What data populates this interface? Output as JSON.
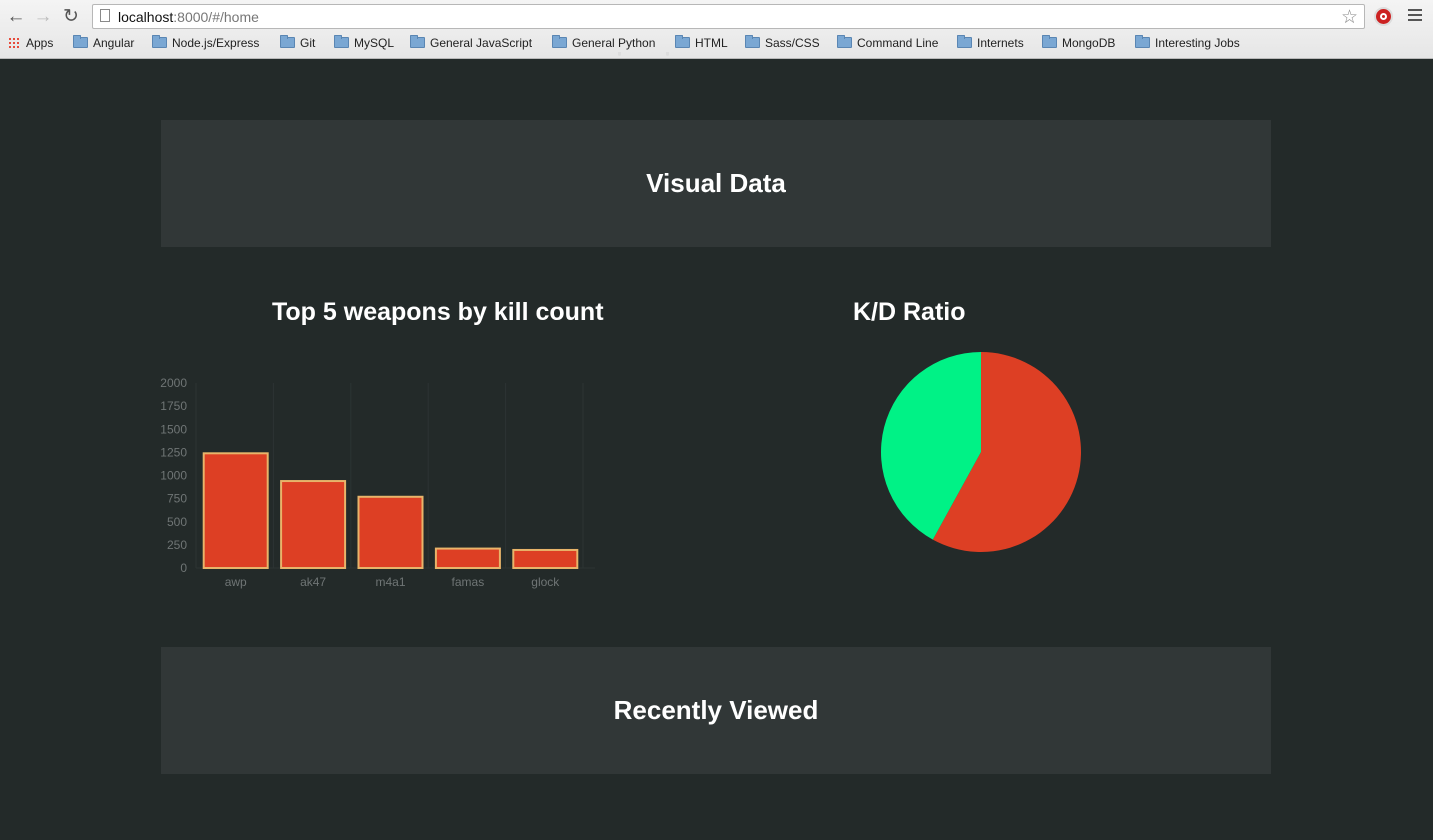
{
  "browser": {
    "url_host": "localhost",
    "url_path": ":8000/#/home",
    "bookmarks": [
      {
        "label": "Apps",
        "icon": "apps-grid-icon"
      },
      {
        "label": "Angular",
        "icon": "folder-icon"
      },
      {
        "label": "Node.js/Express",
        "icon": "folder-icon"
      },
      {
        "label": "Git",
        "icon": "folder-icon"
      },
      {
        "label": "MySQL",
        "icon": "folder-icon"
      },
      {
        "label": "General JavaScript",
        "icon": "folder-icon"
      },
      {
        "label": "General Python",
        "icon": "folder-icon"
      },
      {
        "label": "HTML",
        "icon": "folder-icon"
      },
      {
        "label": "Sass/CSS",
        "icon": "folder-icon"
      },
      {
        "label": "Command Line",
        "icon": "folder-icon"
      },
      {
        "label": "Internets",
        "icon": "folder-icon"
      },
      {
        "label": "MongoDB",
        "icon": "folder-icon"
      },
      {
        "label": "Interesting Jobs",
        "icon": "folder-icon"
      }
    ]
  },
  "page": {
    "visual_section_title": "Visual Data",
    "recent_section_title": "Recently Viewed"
  },
  "colors": {
    "background": "#232a29",
    "panel": "#313737",
    "bar_fill": "#dd3f24",
    "bar_stroke": "#e8b46a",
    "pie_red": "#dd3f24",
    "pie_green": "#00f286",
    "axis_text": "#6f7575"
  },
  "chart_data": [
    {
      "type": "bar",
      "title": "Top 5 weapons by kill count",
      "categories": [
        "awp",
        "ak47",
        "m4a1",
        "famas",
        "glock"
      ],
      "values": [
        1240,
        940,
        770,
        210,
        195
      ],
      "ylim": [
        0,
        2000
      ],
      "yticks": [
        0,
        250,
        500,
        750,
        1000,
        1250,
        1500,
        1750,
        2000
      ],
      "grid": true
    },
    {
      "type": "pie",
      "title": "K/D Ratio",
      "values": [
        58,
        42
      ],
      "colors": [
        "#dd3f24",
        "#00f286"
      ]
    }
  ]
}
